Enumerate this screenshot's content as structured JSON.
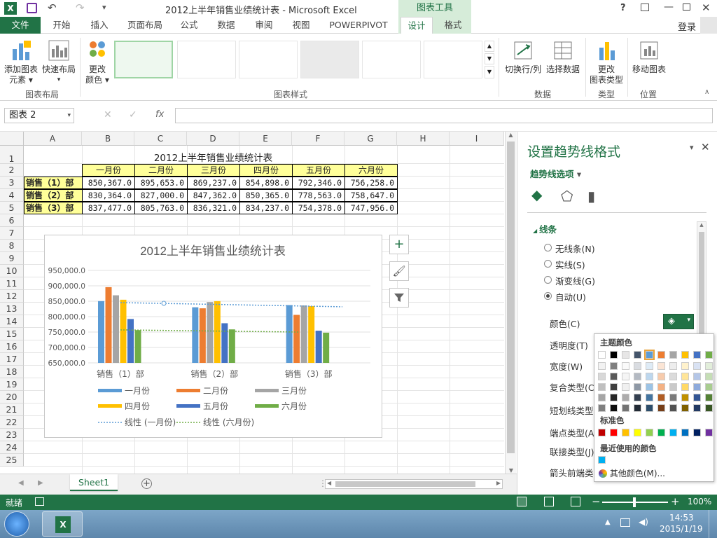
{
  "app": {
    "title": "2012上半年销售业绩统计表 - Microsoft Excel",
    "context_tab_group": "图表工具",
    "help": "?",
    "login": "登录"
  },
  "tabs": [
    "文件",
    "开始",
    "插入",
    "页面布局",
    "公式",
    "数据",
    "审阅",
    "视图",
    "POWERPIVOT",
    "设计",
    "格式"
  ],
  "ribbon": {
    "add_element": "添加图表\n元素",
    "quick_layout": "快速布局",
    "change_colors": "更改\n颜色",
    "group_layout": "图表布局",
    "group_styles": "图表样式",
    "switch_row_col": "切换行/列",
    "select_data": "选择数据",
    "group_data": "数据",
    "change_type": "更改\n图表类型",
    "group_type": "类型",
    "move_chart": "移动图表",
    "group_location": "位置"
  },
  "formula_bar": {
    "name_box": "图表 2",
    "fx": "fx",
    "formula": ""
  },
  "columns": [
    "A",
    "B",
    "C",
    "D",
    "E",
    "F",
    "G",
    "H",
    "I"
  ],
  "rows": [
    "1",
    "2",
    "3",
    "4",
    "5",
    "6",
    "7",
    "8",
    "9",
    "10",
    "11",
    "12",
    "13",
    "14",
    "15",
    "16",
    "17",
    "18",
    "19",
    "20",
    "21",
    "22",
    "23",
    "24",
    "25"
  ],
  "table": {
    "title": "2012上半年销售业绩统计表",
    "headers": [
      "一月份",
      "二月份",
      "三月份",
      "四月份",
      "五月份",
      "六月份"
    ],
    "data": [
      {
        "label": "销售（1）部",
        "values": [
          "850,367.0",
          "895,653.0",
          "869,237.0",
          "854,898.0",
          "792,346.0",
          "756,258.0"
        ]
      },
      {
        "label": "销售（2）部",
        "values": [
          "830,364.0",
          "827,000.0",
          "847,362.0",
          "850,365.0",
          "778,563.0",
          "758,647.0"
        ]
      },
      {
        "label": "销售（3）部",
        "values": [
          "837,477.0",
          "805,763.0",
          "836,321.0",
          "834,237.0",
          "754,378.0",
          "747,956.0"
        ]
      }
    ]
  },
  "chart_data": {
    "type": "bar",
    "title": "2012上半年销售业绩统计表",
    "categories": [
      "销售（1）部",
      "销售（2）部",
      "销售（3）部"
    ],
    "ylim": [
      650000,
      950000
    ],
    "yticks": [
      "950,000.0",
      "900,000.0",
      "850,000.0",
      "800,000.0",
      "750,000.0",
      "700,000.0",
      "650,000.0"
    ],
    "series": [
      {
        "name": "一月份",
        "color": "#5b9bd5",
        "values": [
          850367,
          830364,
          837477
        ]
      },
      {
        "name": "二月份",
        "color": "#ed7d31",
        "values": [
          895653,
          827000,
          805763
        ]
      },
      {
        "name": "三月份",
        "color": "#a5a5a5",
        "values": [
          869237,
          847362,
          836321
        ]
      },
      {
        "name": "四月份",
        "color": "#ffc000",
        "values": [
          854898,
          850365,
          834237
        ]
      },
      {
        "name": "五月份",
        "color": "#4472c4",
        "values": [
          792346,
          778563,
          754378
        ]
      },
      {
        "name": "六月份",
        "color": "#70ad47",
        "values": [
          756258,
          758647,
          747956
        ]
      }
    ],
    "trendlines": [
      {
        "name": "线性 (一月份)",
        "color": "#5b9bd5",
        "values": [
          845500,
          832000
        ]
      },
      {
        "name": "线性 (六月份)",
        "color": "#70ad47",
        "values": [
          757000,
          750000
        ]
      }
    ],
    "legend_position": "bottom",
    "grid": true
  },
  "pane": {
    "title": "设置趋势线格式",
    "options_label": "趋势线选项",
    "section": "线条",
    "radio": [
      "无线条(N)",
      "实线(S)",
      "渐变线(G)",
      "自动(U)"
    ],
    "selected_radio": 3,
    "props": [
      "颜色(C)",
      "透明度(T)",
      "宽度(W)",
      "复合类型(C)",
      "短划线类型(D)",
      "端点类型(A)",
      "联接类型(J)",
      "箭头前端类型"
    ]
  },
  "color_popup": {
    "theme_label": "主题颜色",
    "standard_label": "标准色",
    "recent_label": "最近使用的颜色",
    "more_colors": "其他颜色(M)...",
    "theme_colors": [
      "#ffffff",
      "#000000",
      "#e7e6e6",
      "#44546a",
      "#5b9bd5",
      "#ed7d31",
      "#a5a5a5",
      "#ffc000",
      "#4472c4",
      "#70ad47"
    ],
    "standard_colors": [
      "#c00000",
      "#ff0000",
      "#ffc000",
      "#ffff00",
      "#92d050",
      "#00b050",
      "#00b0f0",
      "#0070c0",
      "#002060",
      "#7030a0"
    ],
    "recent_colors": [
      "#00b0f0"
    ]
  },
  "sheet_tabs": [
    "Sheet1"
  ],
  "status": {
    "ready": "就绪",
    "zoom": "100%"
  },
  "taskbar": {
    "time": "14:53",
    "date": "2015/1/19"
  }
}
